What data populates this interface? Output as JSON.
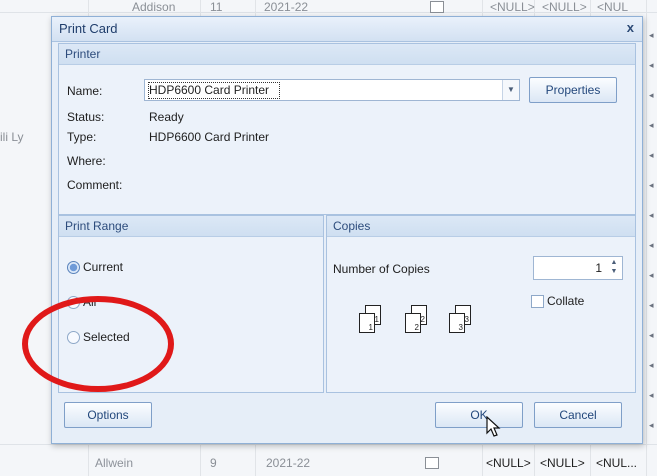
{
  "background": {
    "top_row": {
      "name": "Addison",
      "num": "11",
      "year": "2021-22",
      "c1": "<NULL>",
      "c2": "<NULL>",
      "c3": "<NUL"
    },
    "bottom_row": {
      "name": "Allwein",
      "num": "9",
      "year": "2021-22",
      "c1": "<NULL>",
      "c2": "<NULL>",
      "c3": "<NUL..."
    },
    "left_fragment": "ili Ly"
  },
  "dialog": {
    "title": "Print Card",
    "close_glyph": "x",
    "printer_group": {
      "header": "Printer",
      "name_label": "Name:",
      "name_value": "HDP6600 Card Printer",
      "properties_button": "Properties",
      "status_label": "Status:",
      "status_value": "Ready",
      "type_label": "Type:",
      "type_value": "HDP6600 Card Printer",
      "where_label": "Where:",
      "where_value": "",
      "comment_label": "Comment:",
      "comment_value": ""
    },
    "print_range": {
      "header": "Print Range",
      "options": [
        "Current",
        "All",
        "Selected"
      ],
      "selected": "Current"
    },
    "copies": {
      "header": "Copies",
      "number_label": "Number of Copies",
      "number_value": "1",
      "collate_label": "Collate",
      "collate_checked": false,
      "page_numbers": [
        "1",
        "1",
        "2",
        "2",
        "3",
        "3"
      ]
    },
    "buttons": {
      "options": "Options",
      "ok": "OK",
      "cancel": "Cancel"
    }
  },
  "annotation": {
    "color": "#e01919"
  }
}
